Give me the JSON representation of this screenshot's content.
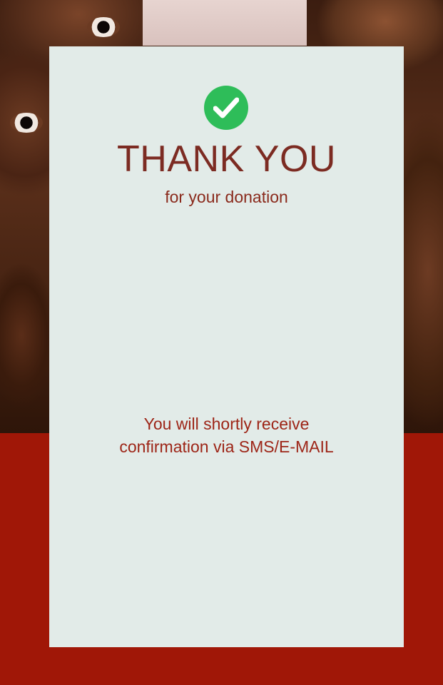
{
  "background": {
    "image": "children-faces-photo",
    "bottom_color": "#a01707"
  },
  "card": {
    "background_color": "#e2ebe8",
    "icon": "check-circle-icon",
    "icon_color": "#2ebd59",
    "title": "THANK YOU",
    "subtitle": "for your donation",
    "message_line1": "You will shortly receive",
    "message_line2": "confirmation via SMS/E-MAIL"
  }
}
